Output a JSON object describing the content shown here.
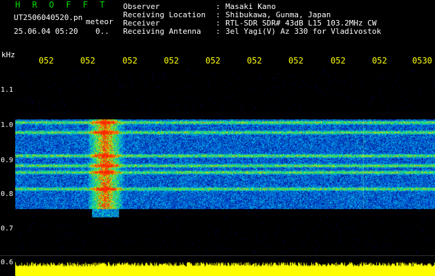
{
  "header": {
    "app_name": "H R O F F T",
    "filename": "UT2506040520.pn",
    "detector_label": "meteor",
    "datetime": "25.06.04 05:20",
    "cursor_value": "0.."
  },
  "info": [
    {
      "label": "Observer",
      "value": "Masaki Kano"
    },
    {
      "label": "Receiving Location",
      "value": "Shibukawa, Gunma, Japan"
    },
    {
      "label": "Receiver",
      "value": "RTL-SDR SDR# 43dB L15 103.2MHz CW"
    },
    {
      "label": "Receiving Antenna",
      "value": "3el Yagi(V) Az 330 for Vladivostok"
    }
  ],
  "separator": ":",
  "axes": {
    "y_unit": "kHz",
    "y_ticks": [
      "1.1",
      "1.0",
      "0.9",
      "0.8",
      "0.7",
      "0.6"
    ],
    "x_ticks": [
      "052",
      "052",
      "052",
      "052",
      "052",
      "052",
      "052",
      "052",
      "052",
      "0530"
    ]
  },
  "colors": {
    "background": "#000000",
    "header_green": "#00e000",
    "tick_yellow": "#ffff00",
    "audio_yellow": "#ffff00"
  },
  "signal": {
    "band_khz": [
      0.76,
      1.03
    ],
    "strong_lines_khz": [
      1.02,
      0.99,
      0.92,
      0.89,
      0.87,
      0.82
    ],
    "meteor_burst_khz": [
      0.77,
      1.02
    ]
  }
}
